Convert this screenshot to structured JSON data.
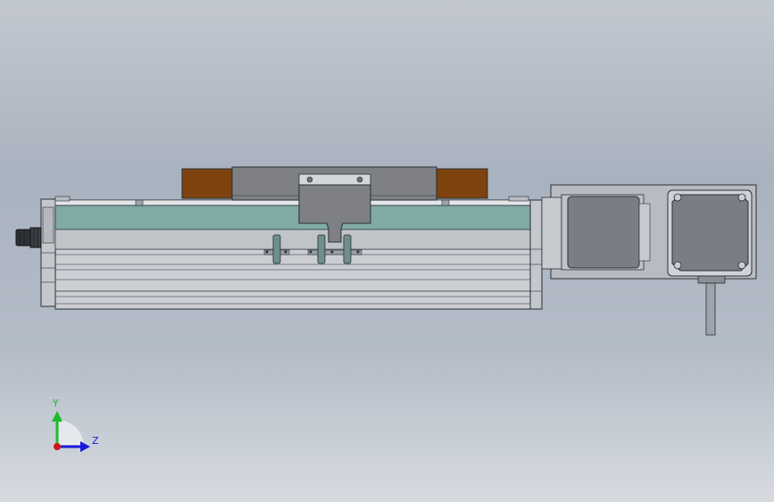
{
  "viewport": {
    "background_top": "#c3c8d0",
    "background_bottom": "#d7dbe0"
  },
  "model": {
    "colors": {
      "rail_body": "#c9cdd2",
      "rail_cover": "#7faaa6",
      "carriage": "#7e8084",
      "bumper": "#7d420e",
      "motor": "#7a7d86",
      "motor_face": "#6f737b",
      "bracket": "#b8bcc2",
      "outline": "#2b2f35"
    }
  },
  "triad": {
    "y_label": "Y",
    "z_label": "Z",
    "y_color": "#1dbb2a",
    "z_color": "#1a1ad6",
    "origin_color": "#d01515"
  }
}
